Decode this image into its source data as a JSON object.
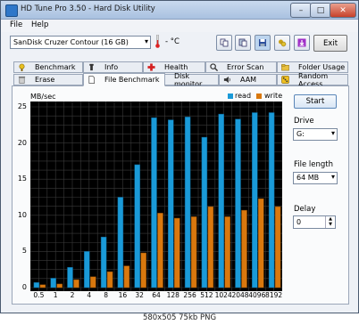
{
  "window": {
    "title": "HD Tune Pro 3.50 - Hard Disk Utility",
    "controls": [
      "–",
      "□",
      "✕"
    ]
  },
  "menu": [
    "File",
    "Help"
  ],
  "toolbar": {
    "drive": "SanDisk Cruzer Contour (16 GB)",
    "temperature": "- °C",
    "exit_label": "Exit"
  },
  "tabs_top": [
    "Benchmark",
    "Info",
    "Health",
    "Error Scan",
    "Folder Usage"
  ],
  "tabs_bottom": [
    "Erase",
    "File Benchmark",
    "Disk monitor",
    "AAM",
    "Random Access"
  ],
  "active_tab": "File Benchmark",
  "side": {
    "start_label": "Start",
    "drive_label": "Drive",
    "drive_value": "G:",
    "file_length_label": "File length",
    "file_length_value": "64 MB",
    "delay_label": "Delay",
    "delay_value": "0"
  },
  "caption": "580x505 75kb PNG",
  "colors": {
    "read": "#1a9ad8",
    "write": "#d9780e"
  },
  "chart_data": {
    "type": "bar",
    "ylabel": "MB/sec",
    "ylim": [
      0,
      25
    ],
    "yticks": [
      0,
      5,
      10,
      15,
      20,
      25
    ],
    "categories": [
      "0.5",
      "1",
      "2",
      "4",
      "8",
      "16",
      "32",
      "64",
      "128",
      "256",
      "512",
      "1024",
      "2048",
      "4096",
      "8192"
    ],
    "series": [
      {
        "name": "read",
        "values": [
          0.7,
          1.3,
          2.8,
          5.0,
          7.0,
          12.5,
          17.0,
          23.5,
          23.2,
          23.6,
          20.8,
          24.0,
          23.3,
          24.2,
          24.2
        ]
      },
      {
        "name": "write",
        "values": [
          0.4,
          0.5,
          1.1,
          1.5,
          2.2,
          3.0,
          4.8,
          10.3,
          9.6,
          9.8,
          11.2,
          9.8,
          10.7,
          12.3,
          11.2
        ]
      }
    ],
    "grid": true,
    "legend": "top-right"
  }
}
